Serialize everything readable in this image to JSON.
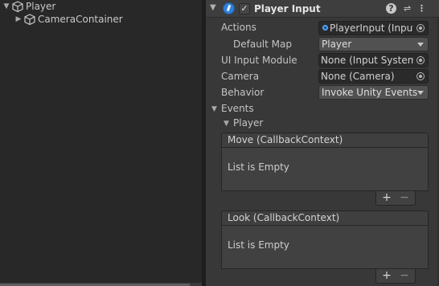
{
  "hierarchy": {
    "items": [
      {
        "label": "Player",
        "expanded": true,
        "icon": "gameobject-cube-icon"
      },
      {
        "label": "CameraContainer",
        "expanded": false,
        "icon": "gameobject-cube-icon"
      }
    ]
  },
  "inspector": {
    "component": {
      "title": "Player Input",
      "enabled_mark": "✓",
      "icons": {
        "help": "?",
        "presets": "⇌",
        "menu": "⋮"
      }
    },
    "fields": {
      "actions": {
        "label": "Actions",
        "value": "PlayerInput (Input"
      },
      "default_map": {
        "label": "Default Map",
        "value": "Player"
      },
      "ui_input_module": {
        "label": "UI Input Module",
        "value": "None (Input System U"
      },
      "camera": {
        "label": "Camera",
        "value": "None (Camera)"
      },
      "behavior": {
        "label": "Behavior",
        "value": "Invoke Unity Events"
      }
    },
    "events": {
      "label": "Events",
      "group": "Player",
      "lists": [
        {
          "header": "Move (CallbackContext)",
          "empty_text": "List is Empty",
          "add": "+",
          "remove": "−"
        },
        {
          "header": "Look (CallbackContext)",
          "empty_text": "List is Empty",
          "add": "+",
          "remove": "−"
        }
      ]
    }
  },
  "colors": {
    "hierarchy_bg": "#282828",
    "inspector_bg": "#383838",
    "field_bg": "#2a2a2a",
    "dropdown_bg": "#515151",
    "accent_icon": "#2f7fd6"
  }
}
